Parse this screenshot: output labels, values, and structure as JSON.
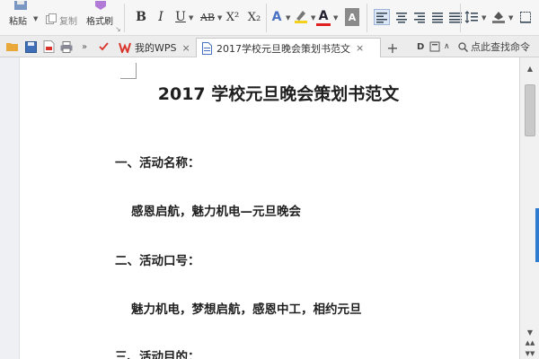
{
  "ribbon": {
    "paste_label": "粘贴",
    "copy_label": "复制",
    "format_painter_label": "格式刷",
    "bold": "B",
    "italic": "I",
    "underline": "U",
    "strikethrough_ab": "AB",
    "superscript": "X²",
    "subscript": "X₂",
    "text_effect": "A",
    "font_color": "A",
    "char_shading": "A"
  },
  "tabbar": {
    "tabs": [
      {
        "label": "我的WPS"
      },
      {
        "label": "2017学校元旦晚会策划书范文"
      }
    ],
    "add_tab": "+",
    "search_text": "点此查找命令"
  },
  "document": {
    "title": "2017 学校元旦晚会策划书范文",
    "paragraphs": [
      "一、活动名称：",
      "感恩启航，魅力机电—元旦晚会",
      "二、活动口号：",
      "魅力机电，梦想启航，感恩中工，相约元旦",
      "三、活动目的："
    ]
  },
  "colors": {
    "wps_red": "#d9342b",
    "font_color_red": "#e02020",
    "highlight_yellow": "#f3d11a",
    "accent_blue": "#2e7bd0"
  }
}
